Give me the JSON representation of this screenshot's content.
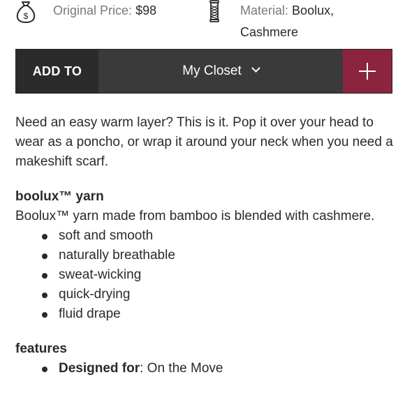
{
  "info": {
    "price_label": "Original Price:",
    "price_value": "$98",
    "price_icon": "money-bag-icon",
    "material_label": "Material:",
    "material_value": "Boolux,",
    "material_value_line2": "Cashmere",
    "material_icon": "yarn-spool-icon"
  },
  "add_bar": {
    "add_label": "ADD TO",
    "closet_selected": "My Closet",
    "plus_icon": "plus-icon",
    "accent_color": "#8c2440"
  },
  "description": "Need an easy warm layer? This is it. Pop it over your head to wear as a poncho, or wrap it around your neck when you need a makeshift scarf.",
  "yarn_section": {
    "heading": "boolux™ yarn",
    "text": "Boolux™ yarn made from bamboo is blended with cashmere.",
    "bullets": [
      "soft and smooth",
      "naturally breathable",
      "sweat-wicking",
      "quick-drying",
      "fluid drape"
    ]
  },
  "features_section": {
    "heading": "features",
    "items": [
      {
        "label": "Designed for",
        "value": ": On the Move"
      }
    ]
  }
}
